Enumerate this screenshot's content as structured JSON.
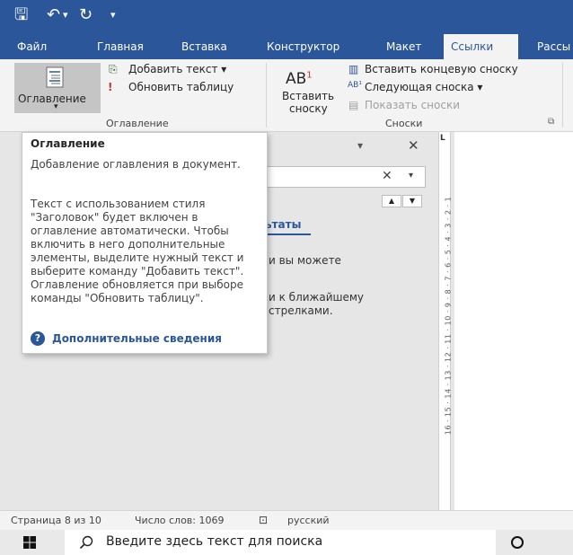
{
  "quick_access": {
    "save_icon": "save-icon",
    "undo_icon": "undo-icon",
    "redo_icon": "redo-icon",
    "customize_icon": "customize-qat-icon"
  },
  "tabs": [
    "Файл",
    "Главная",
    "Вставка",
    "Конструктор",
    "Макет",
    "Ссылки",
    "Рассы"
  ],
  "active_tab": "Ссылки",
  "ribbon": {
    "toc_button": "Оглавление",
    "add_text": "Добавить текст",
    "update_table": "Обновить таблицу",
    "toc_group": "Оглавление",
    "insert_footnote_line1": "Вставить",
    "insert_footnote_line2": "сноску",
    "insert_endnote": "Вставить концевую сноску",
    "next_footnote": "Следующая сноска",
    "show_notes": "Показать сноски",
    "footnotes_group": "Сноски"
  },
  "tooltip": {
    "title": "Оглавление",
    "para1": "Добавление оглавления в документ.",
    "para2": "Текст с использованием стиля \"Заголовок\" будет включен в оглавление автоматически. Чтобы включить в него дополнительные элементы, выделите нужный текст и выберите команду \"Добавить текст\". Оглавление обновляется при выборе команды \"Обновить таблицу\".",
    "link": "Дополнительные сведения"
  },
  "nav_pane": {
    "results_tab": "ьтаты",
    "line1": "и вы можете",
    "line2": "и к ближайшему",
    "line3": "стрелками."
  },
  "ruler_text": "16 · 15 · 14 · 13 · 12 · 11 · 10 · 9 · 8 · 7 · 6 · 5 · 4 · 3 · 2 · 1",
  "status": {
    "page": "Страница 8 из 10",
    "words": "Число слов: 1069",
    "language": "русский"
  },
  "taskbar": {
    "search_placeholder": "Введите здесь текст для поиска"
  },
  "colors": {
    "accent": "#2b579a",
    "ribbon_bg": "#f3f3f3",
    "work_bg": "#e6e6e6"
  }
}
